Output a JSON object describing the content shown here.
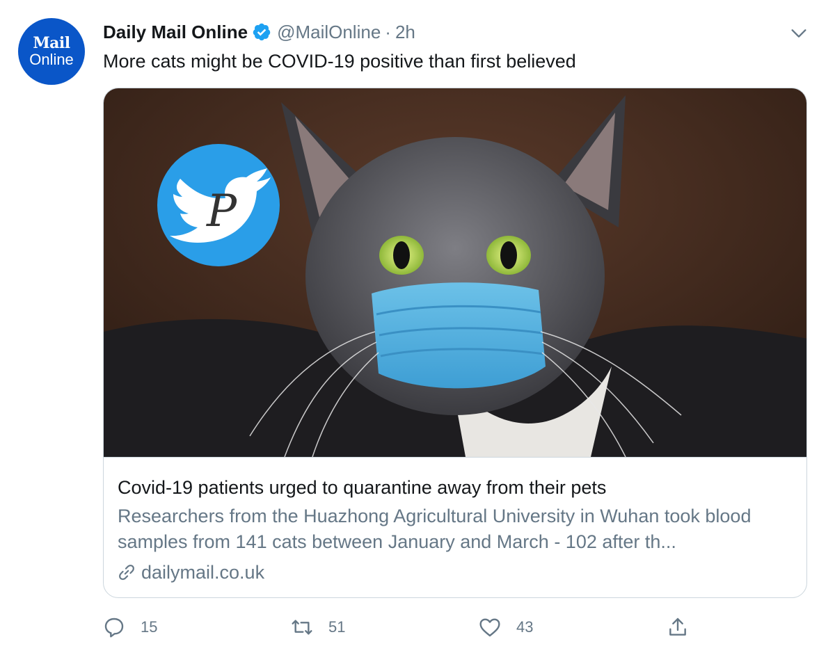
{
  "author": {
    "avatar_line1": "Mail",
    "avatar_line2": "Online",
    "name": "Daily Mail Online",
    "handle": "@MailOnline",
    "separator": "·",
    "time": "2h"
  },
  "tweet": {
    "text": "More cats might be COVID-19 positive than first believed"
  },
  "card": {
    "image_icon": "cat-wearing-mask-photo",
    "title": "Covid-19 patients urged to quarantine away from their pets",
    "description": "Researchers from the Huazhong Agricultural University in Wuhan took blood samples from 141 cats between January and March - 102 after th...",
    "domain": "dailymail.co.uk"
  },
  "actions": {
    "reply_count": "15",
    "retweet_count": "51",
    "like_count": "43"
  },
  "colors": {
    "avatar_bg": "#0a56c8",
    "verified": "#1da1f2",
    "secondary_text": "#657786",
    "border": "#ccd6dd"
  }
}
